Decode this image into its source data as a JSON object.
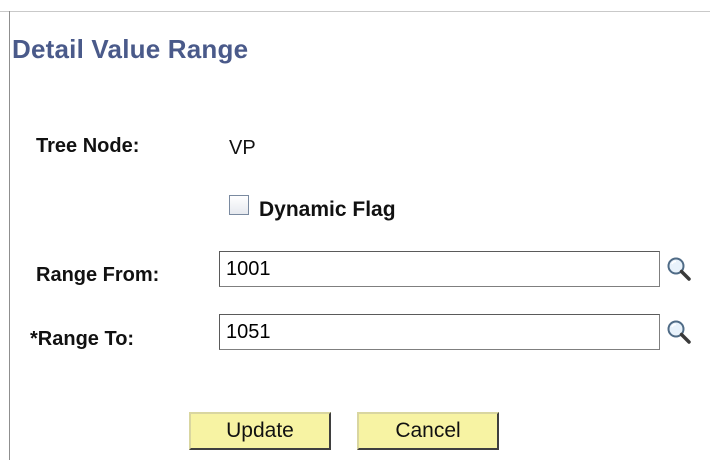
{
  "page": {
    "title": "Detail Value Range"
  },
  "tree_node": {
    "label": "Tree Node:",
    "value": "VP"
  },
  "dynamic_flag": {
    "label": "Dynamic Flag",
    "checked": false
  },
  "range_from": {
    "label": "Range From:",
    "value": "1001",
    "icon": "lookup-magnifier-icon"
  },
  "range_to": {
    "label": "*Range To:",
    "value": "1051",
    "icon": "lookup-magnifier-icon"
  },
  "buttons": {
    "update": "Update",
    "cancel": "Cancel"
  }
}
